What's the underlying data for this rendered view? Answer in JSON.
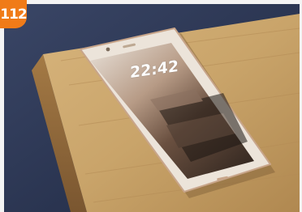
{
  "badge": {
    "number": "112"
  },
  "lockscreen": {
    "time": "22:42"
  },
  "colors": {
    "badge": "#f07b18",
    "background": "#2a3550",
    "wood": "#c9a46a",
    "phone_frame": "#ece4da",
    "screen": "#3a2e26"
  }
}
